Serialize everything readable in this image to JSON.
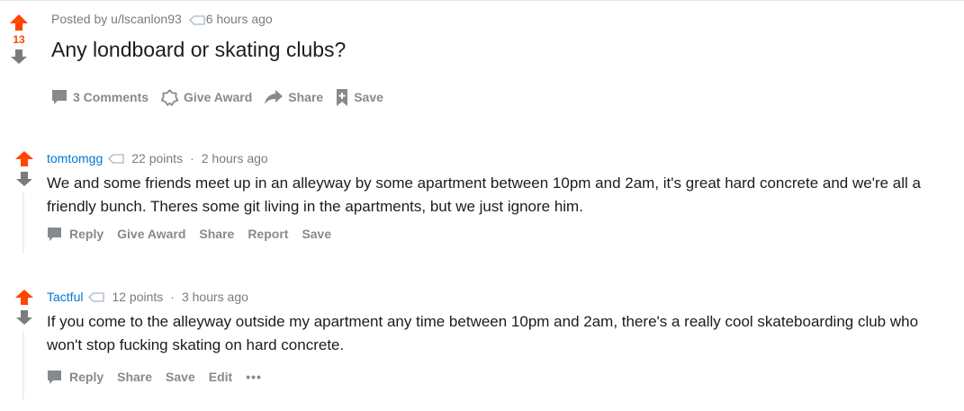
{
  "post": {
    "score": "13",
    "posted_by": "Posted by u/lscanlon93",
    "time": "6 hours ago",
    "title": "Any londboard or skating clubs?",
    "actions": {
      "comments": "3 Comments",
      "give_award": "Give Award",
      "share": "Share",
      "save": "Save"
    }
  },
  "comments": [
    {
      "author": "tomtomgg",
      "points": "22 points",
      "separator": "·",
      "time": "2 hours ago",
      "body": "We and some friends meet up in an alleyway by some apartment between 10pm and 2am, it's great hard concrete and we're all a friendly bunch. Theres some git living in the apartments, but we just ignore him.",
      "actions": {
        "reply": "Reply",
        "give_award": "Give Award",
        "share": "Share",
        "report": "Report",
        "save": "Save"
      }
    },
    {
      "author": "Tactful",
      "points": "12 points",
      "separator": "·",
      "time": "3 hours ago",
      "body": "If you come to the alleyway outside my apartment any time between 10pm and 2am, there's a really cool skateboarding club who won't stop fucking skating on hard concrete.",
      "actions": {
        "reply": "Reply",
        "share": "Share",
        "save": "Save",
        "edit": "Edit",
        "more": "•••"
      }
    }
  ],
  "colors": {
    "upvote": "#ff4500",
    "downvote": "#878a8c",
    "author_link": "#0079d3",
    "meta_text": "#787c7e",
    "action_text": "#878a8c"
  },
  "icons": [
    "upvote-arrow-icon",
    "downvote-arrow-icon",
    "tag-icon",
    "comment-bubble-icon",
    "award-icon",
    "share-arrow-icon",
    "bookmark-plus-icon"
  ]
}
